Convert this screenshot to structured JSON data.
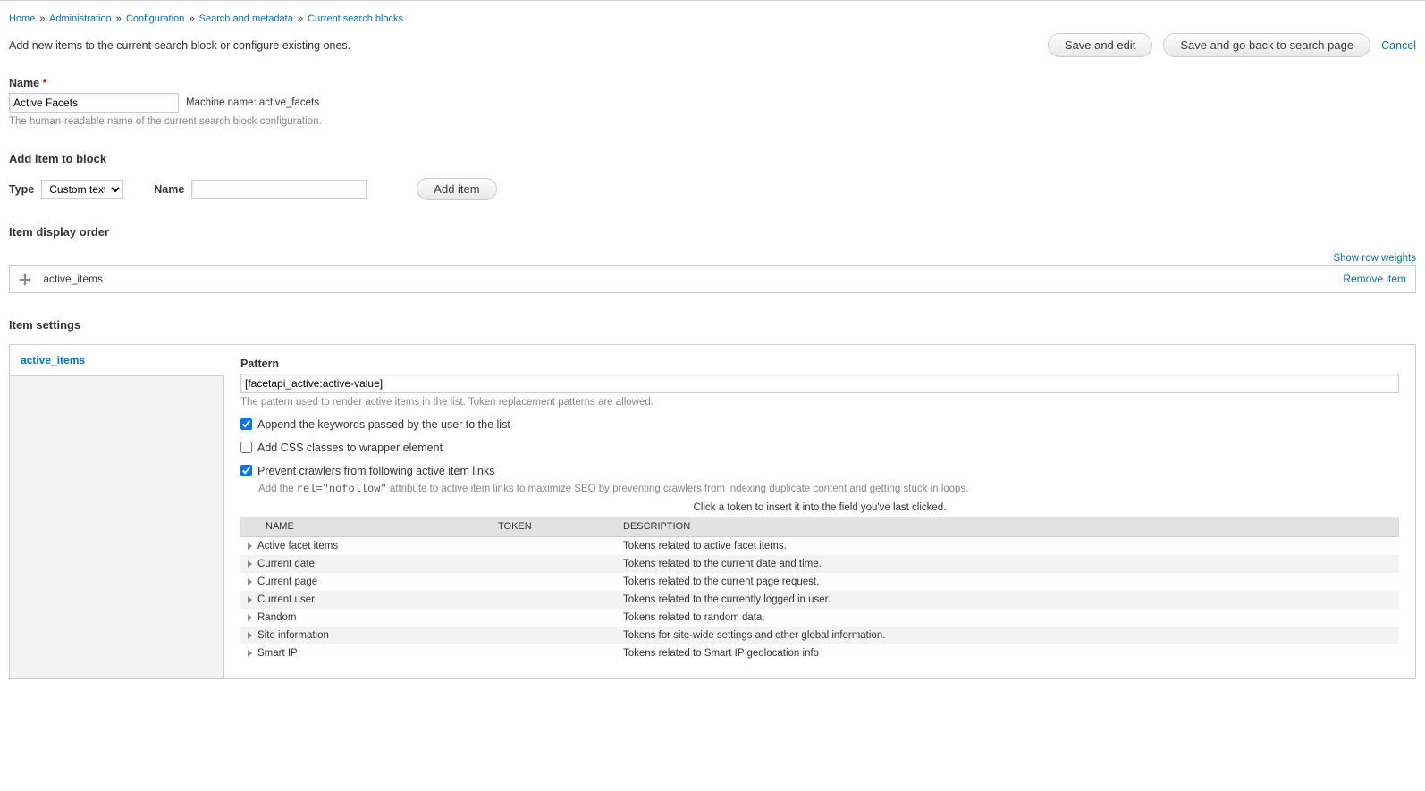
{
  "breadcrumb": {
    "items": [
      "Home",
      "Administration",
      "Configuration",
      "Search and metadata",
      "Current search blocks"
    ],
    "sep": "»"
  },
  "intro": "Add new items to the current search block or configure existing ones.",
  "buttons": {
    "save_edit": "Save and edit",
    "save_back": "Save and go back to search page",
    "cancel": "Cancel",
    "add_item": "Add item"
  },
  "name": {
    "label": "Name",
    "value": "Active Facets",
    "machine_prefix": "Machine name:",
    "machine_value": "active_facets",
    "desc": "The human-readable name of the current search block configuration."
  },
  "add_block": {
    "heading": "Add item to block",
    "type_label": "Type",
    "type_value": "Custom text",
    "name_label": "Name",
    "name_value": ""
  },
  "order": {
    "heading": "Item display order",
    "show_weights": "Show row weights",
    "rows": [
      {
        "label": "active_items",
        "remove": "Remove item"
      }
    ]
  },
  "settings": {
    "heading": "Item settings",
    "tabs": [
      {
        "id": "active_items",
        "label": "active_items",
        "active": true
      }
    ],
    "pattern": {
      "label": "Pattern",
      "value": "[facetapi_active:active-value]",
      "desc": "The pattern used to render active items in the list. Token replacement patterns are allowed."
    },
    "check_append": {
      "label": "Append the keywords passed by the user to the list",
      "checked": true
    },
    "check_css": {
      "label": "Add CSS classes to wrapper element",
      "checked": false
    },
    "check_nofollow": {
      "label": "Prevent crawlers from following active item links",
      "checked": true,
      "desc_pre": "Add the ",
      "desc_code": "rel=\"nofollow\"",
      "desc_post": " attribute to active item links to maximize SEO by preventing crawlers from indexing duplicate content and getting stuck in loops."
    },
    "token_caption": "Click a token to insert it into the field you've last clicked.",
    "token_headers": {
      "name": "NAME",
      "token": "TOKEN",
      "desc": "DESCRIPTION"
    },
    "tokens": [
      {
        "name": "Active facet items",
        "token": "",
        "desc": "Tokens related to active facet items."
      },
      {
        "name": "Current date",
        "token": "",
        "desc": "Tokens related to the current date and time."
      },
      {
        "name": "Current page",
        "token": "",
        "desc": "Tokens related to the current page request."
      },
      {
        "name": "Current user",
        "token": "",
        "desc": "Tokens related to the currently logged in user."
      },
      {
        "name": "Random",
        "token": "",
        "desc": "Tokens related to random data."
      },
      {
        "name": "Site information",
        "token": "",
        "desc": "Tokens for site-wide settings and other global information."
      },
      {
        "name": "Smart IP",
        "token": "",
        "desc": "Tokens related to Smart IP geolocation info"
      }
    ]
  }
}
